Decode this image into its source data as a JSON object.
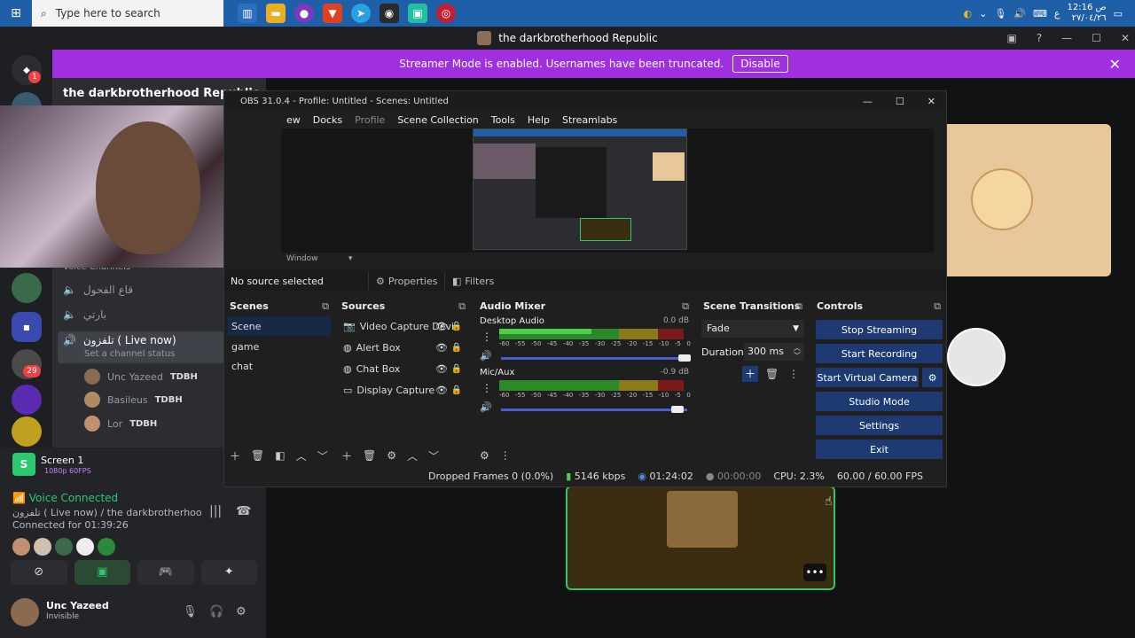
{
  "taskbar": {
    "search_placeholder": "Type here to search",
    "clock_time": "12:16 ص",
    "clock_date": "٢٧/٠٤/٢٦",
    "lang": "ع"
  },
  "discord": {
    "window_title": "the darkbrotherhood Republic",
    "banner_text": "Streamer Mode is enabled. Usernames have been truncated.",
    "banner_button": "Disable",
    "server_name": "the darkbrotherhood Republic",
    "section_label": "Voice Channels",
    "channels": [
      "قاع الفحول",
      "بارتي",
      "تلفزون ( Live now)"
    ],
    "channel_status": "Set a channel status",
    "members": [
      {
        "name": "Unc Yazeed",
        "tag": "TDBH"
      },
      {
        "name": "Basileus",
        "tag": "TDBH"
      },
      {
        "name": "Lor",
        "tag": "TDBH"
      }
    ],
    "badges": {
      "discord": "1",
      "server": "29"
    },
    "screen_share": {
      "title": "Screen 1",
      "quality": "1080p 60FPS"
    },
    "voice": {
      "status": "Voice Connected",
      "location": "تلفزون ( Live now) / the darkbrotherhood ...",
      "connected_for": "Connected for 01:39:26"
    },
    "user": {
      "name": "Unc Yazeed",
      "status": "Invisible"
    }
  },
  "obs": {
    "title": "OBS 31.0.4 - Profile: Untitled - Scenes: Untitled",
    "menu": [
      "ew",
      "Docks",
      "Profile",
      "Scene Collection",
      "Tools",
      "Help",
      "Streamlabs"
    ],
    "window_label": "Window",
    "no_source": "No source selected",
    "properties_label": "Properties",
    "filters_label": "Filters",
    "scenes_header": "Scenes",
    "scenes": [
      "Scene",
      "game",
      "chat"
    ],
    "sources_header": "Sources",
    "sources": [
      "Video Capture Devi",
      "Alert Box",
      "Chat Box",
      "Display Capture"
    ],
    "mixer_header": "Audio Mixer",
    "mixer": [
      {
        "name": "Desktop Audio",
        "db": "0.0 dB",
        "level": 0.5
      },
      {
        "name": "Mic/Aux",
        "db": "-0.9 dB",
        "level": 0.0
      }
    ],
    "scale_ticks": [
      "-60",
      "-55",
      "-50",
      "-45",
      "-40",
      "-35",
      "-30",
      "-25",
      "-20",
      "-15",
      "-10",
      "-5",
      "0"
    ],
    "transitions_header": "Scene Transitions",
    "transition": "Fade",
    "duration_label": "Duration",
    "duration_value": "300 ms",
    "controls_header": "Controls",
    "controls": [
      "Stop Streaming",
      "Start Recording",
      "Start Virtual Camera",
      "Studio Mode",
      "Settings",
      "Exit"
    ],
    "status": {
      "dropped": "Dropped Frames 0 (0.0%)",
      "kbps": "5146 kbps",
      "stream_time": "01:24:02",
      "rec_time": "00:00:00",
      "cpu": "CPU: 2.3%",
      "fps": "60.00 / 60.00 FPS"
    }
  },
  "colors": {
    "accent": "#a02fe0",
    "obs_button": "#1d3a73",
    "voice_green": "#2dc770"
  }
}
